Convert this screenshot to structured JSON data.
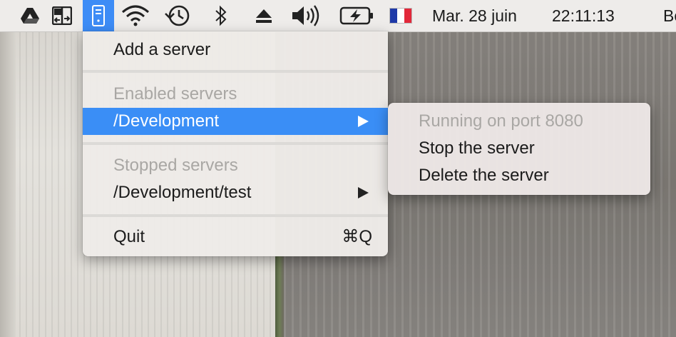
{
  "menubar": {
    "date": "Mar. 28 juin",
    "time": "22:11:13",
    "user_partial": "Bo"
  },
  "menu": {
    "add_server": "Add a server",
    "enabled_header": "Enabled servers",
    "enabled_item": "/Development",
    "stopped_header": "Stopped servers",
    "stopped_item": "/Development/test",
    "quit": "Quit",
    "quit_shortcut": "⌘Q"
  },
  "submenu": {
    "status": "Running on port 8080",
    "stop": "Stop the server",
    "delete": "Delete the server"
  },
  "colors": {
    "accent": "#3a8ef6",
    "menu_bg": "#eeebe8",
    "disabled_text": "#a9a7a4"
  }
}
